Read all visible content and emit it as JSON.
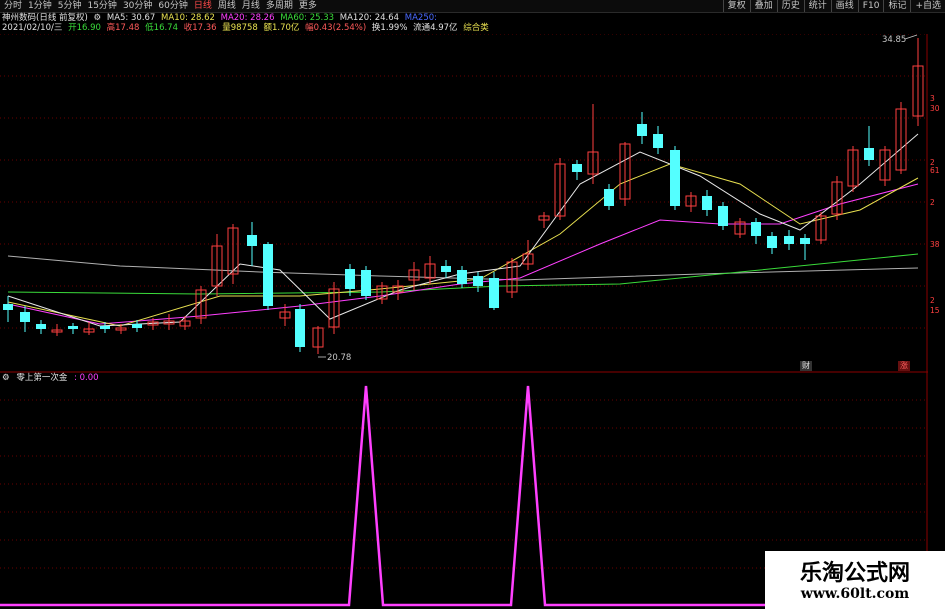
{
  "toolbar": {
    "periods": [
      "分时",
      "1分钟",
      "5分钟",
      "15分钟",
      "30分钟",
      "60分钟",
      "日线",
      "周线",
      "月线",
      "多周期",
      "更多"
    ],
    "active_period": "日线",
    "right_tools": [
      "复权",
      "叠加",
      "历史",
      "统计",
      "画线",
      "F10",
      "标记",
      "+自选"
    ]
  },
  "info": {
    "stock_title": "神州数码(日线 前复权)",
    "ma5": "MA5: 30.67",
    "ma10": "MA10: 28.62",
    "ma20": "MA20: 28.26",
    "ma60": "MA60: 25.33",
    "ma120": "MA120: 24.64",
    "ma250": "MA250:",
    "date": "2021/02/10/三",
    "open": "开16.90",
    "high": "高17.48",
    "low": "低16.74",
    "close": "收17.36",
    "volume": "量98758",
    "amount": "额1.70亿",
    "change": "幅0.43(2.54%)",
    "turnover": "换1.99%",
    "float_cap": "流通4.97亿",
    "sector": "综合类"
  },
  "annotations": {
    "high_label": "34.85",
    "low_label": "20.78",
    "badge_cai": "财",
    "badge_zhang": "涨"
  },
  "right_axis_labels": [
    "3",
    "30",
    "2",
    "61",
    "2",
    "38",
    "2",
    "15"
  ],
  "indicator": {
    "name": "零上第一次金",
    "value": ": 0.00",
    "spikes": [
      {
        "bar_index": 22,
        "value": 1
      },
      {
        "bar_index": 32,
        "value": 1
      }
    ]
  },
  "colors": {
    "up": "#ff4040",
    "down": "#54ffff",
    "ma5": "#e8e8e8",
    "ma10": "#e8e050",
    "ma20": "#ff40ff",
    "ma60": "#3adb3a",
    "ma120": "#b0b0b0",
    "indicator": "#ff40ff",
    "grid": "#8b0000"
  },
  "watermark": {
    "title": "乐淘公式网",
    "url": "www.60lt.com"
  }
}
